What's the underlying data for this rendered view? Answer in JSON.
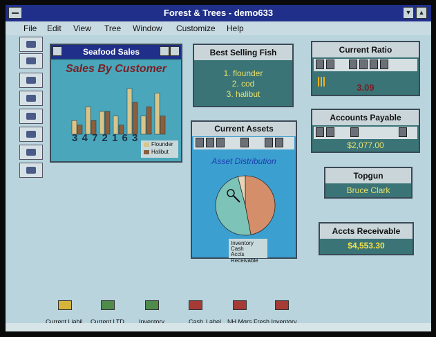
{
  "window": {
    "title": "Forest & Trees - demo633"
  },
  "menubar": [
    "File",
    "Edit",
    "View",
    "Tree",
    "Window",
    "Customize",
    "Help"
  ],
  "panels": {
    "seafood": {
      "title": "Seafood Sales",
      "chart_title": "Sales By Customer",
      "x_numbers": "3 4 7 2 1 6 3",
      "legend": [
        "Flounder",
        "Halibut"
      ]
    },
    "best_selling": {
      "title": "Best Selling Fish",
      "items": [
        "1. flounder",
        "2. cod",
        "3. halibut"
      ]
    },
    "current_assets": {
      "title": "Current Assets",
      "chart_title": "Asset Distribution",
      "legend": [
        "Inventory",
        "Cash",
        "Accts Receivable"
      ]
    },
    "current_ratio": {
      "title": "Current Ratio",
      "value": "3.09"
    },
    "accounts_payable": {
      "title": "Accounts Payable",
      "value": "$2,077.00"
    },
    "topgun": {
      "title": "Topgun",
      "value": "Bruce Clark"
    },
    "accts_receivable": {
      "title": "Accts Receivable",
      "value": "$4,553.30"
    }
  },
  "bottom_icons": [
    {
      "label": "Current Liabil",
      "color": "#d6b33b"
    },
    {
      "label": "Current LTD",
      "color": "#4f8b4b"
    },
    {
      "label": "Inventory",
      "color": "#4f8b4b"
    },
    {
      "label": "Cash",
      "color": "#a63a34"
    },
    {
      "label": "Label",
      "color": "#a63a34"
    },
    {
      "label": "NH Mgrs",
      "color": "#a63a34"
    },
    {
      "label": "Fresh Inventory",
      "color": "#d6b33b"
    }
  ],
  "chart_data": [
    {
      "type": "bar",
      "title": "Sales By Customer",
      "categories": [
        "3",
        "4",
        "7",
        "2",
        "1",
        "6",
        "3"
      ],
      "series": [
        {
          "name": "Flounder",
          "values": [
            3,
            6,
            5,
            4,
            10,
            4,
            9
          ]
        },
        {
          "name": "Halibut",
          "values": [
            2,
            3,
            5,
            2,
            7,
            6,
            4
          ]
        }
      ],
      "ylim": [
        0,
        10
      ],
      "legend": "bottom-right",
      "colors": {
        "Flounder": "#d9c48a",
        "Halibut": "#8b5e3c"
      }
    },
    {
      "type": "pie",
      "title": "Asset Distribution",
      "labels": [
        "Inventory",
        "Cash",
        "Accts Receivable"
      ],
      "values": [
        0.47,
        0.49,
        0.04
      ],
      "colors": {
        "Inventory": "#d48f6a",
        "Cash": "#7ec3b7",
        "Accts Receivable": "#e7d3b8"
      }
    }
  ]
}
